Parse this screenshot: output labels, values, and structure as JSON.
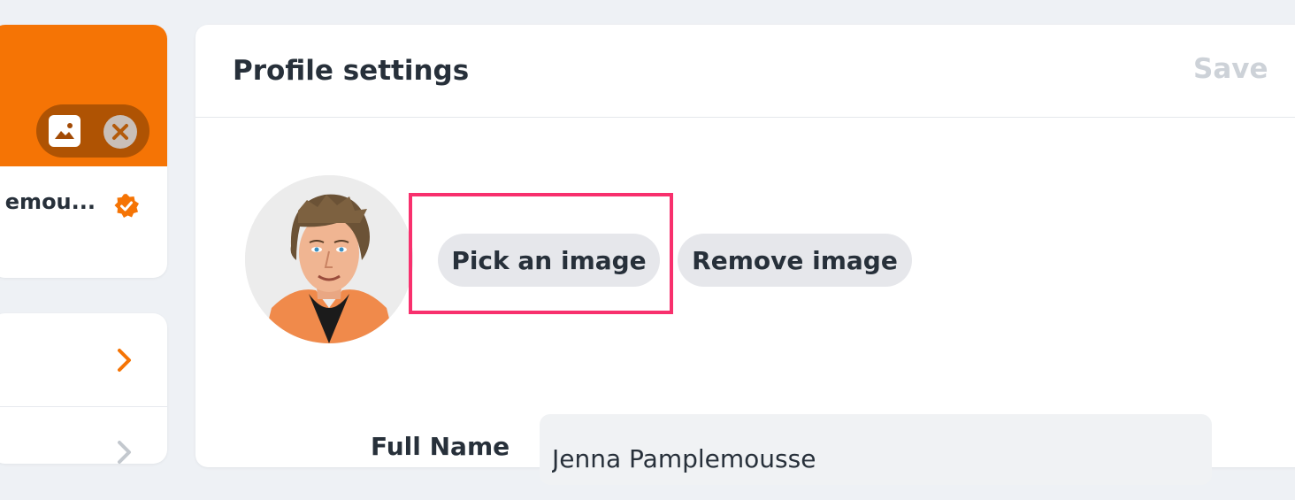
{
  "sidebar": {
    "profile_name": "emou...",
    "banner_color": "#f57405",
    "icons": [
      "image-icon",
      "close-icon",
      "verified-icon",
      "chevron-right-icon"
    ]
  },
  "panel": {
    "title": "Profile settings",
    "save_label": "Save"
  },
  "avatar": {
    "pick_label": "Pick an image",
    "remove_label": "Remove image"
  },
  "form": {
    "full_name_label": "Full Name",
    "full_name_value": "Jenna Pamplemousse"
  },
  "colors": {
    "accent": "#f57405",
    "highlight": "#f8306d",
    "pill_bg": "#e6e7eb",
    "save_disabled": "#cdd2d8"
  }
}
